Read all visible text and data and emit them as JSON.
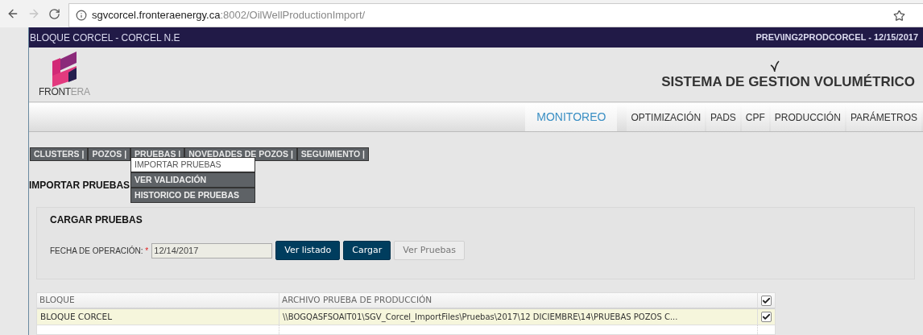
{
  "browser": {
    "url_host": "sgvcorcel.fronteraenergy.ca",
    "url_path": ":8002/OilWellProductionImport/",
    "forward_disabled": true
  },
  "header": {
    "left": "BLOQUE CORCEL - CORCEL N.E",
    "right": "PREV\\ING2PRODCORCEL - 12/15/2017"
  },
  "logo": {
    "text_dark": "FRONT",
    "text_light": "ERA"
  },
  "system_title": "SISTEMA DE GESTION VOLUMÉTRICO",
  "nav_tabs": [
    {
      "label": "MONITOREO",
      "selected": true
    },
    {
      "label": "OPTIMIZACIÓN",
      "selected": false
    },
    {
      "label": "PADS",
      "selected": false
    },
    {
      "label": "CPF",
      "selected": false
    },
    {
      "label": "PRODUCCIÓN",
      "selected": false
    },
    {
      "label": "PARÁMETROS",
      "selected": false
    }
  ],
  "submenu": [
    {
      "label": "CLUSTERS |"
    },
    {
      "label": "POZOS |"
    },
    {
      "label": "PRUEBAS |",
      "children": [
        {
          "label": "IMPORTAR PRUEBAS",
          "selected": true
        },
        {
          "label": "VER VALIDACIÓN",
          "selected": false
        },
        {
          "label": "HISTORICO DE PRUEBAS",
          "selected": false
        }
      ]
    },
    {
      "label": "NOVEDADES DE POZOS |"
    },
    {
      "label": "SEGUIMIENTO |"
    }
  ],
  "page_title": "IMPORTAR PRUEBAS",
  "panel": {
    "title": "CARGAR PRUEBAS",
    "date_label": "FECHA DE OPERACIÓN:",
    "required_mark": "*",
    "date_value": "12/14/2017",
    "buttons": [
      {
        "label": "Ver listado",
        "disabled": false
      },
      {
        "label": "Cargar",
        "disabled": false
      },
      {
        "label": "Ver Pruebas",
        "disabled": true
      }
    ]
  },
  "table": {
    "columns": [
      "BLOQUE",
      "ARCHIVO PRUEBA DE PRODUCCIÓN"
    ],
    "header_checked": true,
    "rows": [
      {
        "bloque": "BLOQUE CORCEL",
        "archivo": "\\\\BOGQASFSOAIT01\\SGV_Corcel_ImportFiles\\Pruebas\\2017\\12 DICIEMBRE\\14\\PRUEBAS POZOS C...",
        "checked": true
      }
    ]
  }
}
